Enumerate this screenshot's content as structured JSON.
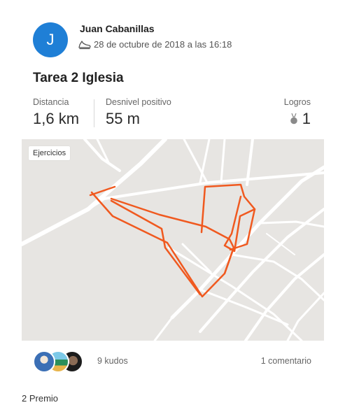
{
  "athlete": {
    "avatar_initial": "J",
    "name": "Juan Cabanillas",
    "activity_icon": "run-shoe-icon",
    "timestamp": "28 de octubre de 2018 a las 16:18"
  },
  "activity": {
    "title": "Tarea 2 Iglesia"
  },
  "stats": {
    "distance": {
      "label": "Distancia",
      "value": "1,6 km"
    },
    "elevation": {
      "label": "Desnivel positivo",
      "value": "55 m"
    },
    "achievements": {
      "label": "Logros",
      "value": "1",
      "icon": "medal-icon"
    }
  },
  "map": {
    "badge": "Ejercicios",
    "route_color": "#f0591f"
  },
  "social": {
    "kudos": "9 kudos",
    "comments": "1 comentario"
  },
  "footer": {
    "text": "2 Premio"
  },
  "colors": {
    "avatar": "#1f7fd6",
    "route": "#f0591f",
    "map_bg": "#e7e5e2",
    "road": "#ffffff"
  }
}
